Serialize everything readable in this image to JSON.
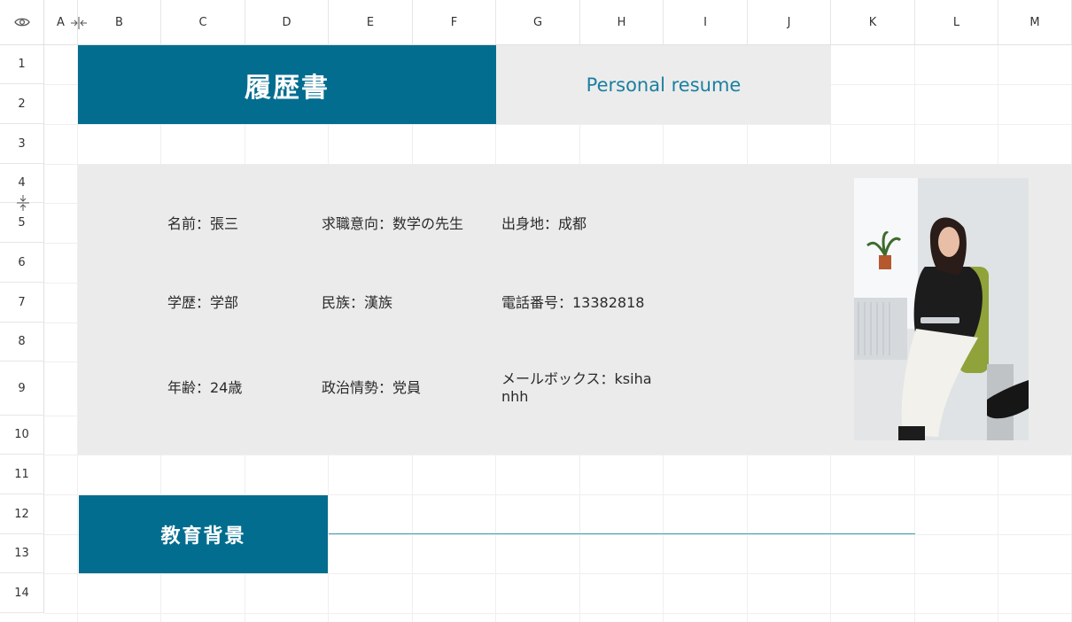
{
  "columns": [
    "A",
    "B",
    "C",
    "D",
    "E",
    "F",
    "G",
    "H",
    "I",
    "J",
    "K",
    "L",
    "M"
  ],
  "rows": [
    "1",
    "2",
    "3",
    "4",
    "5",
    "6",
    "7",
    "8",
    "9",
    "10",
    "11",
    "12",
    "13",
    "14"
  ],
  "icons": {
    "corner": "eye-icon",
    "column_resize": "column-resize-icon",
    "row_resize": "row-resize-icon"
  },
  "header": {
    "title": "履歴書",
    "subtitle": "Personal resume"
  },
  "info": {
    "name": "名前：張三",
    "objective": "求職意向：数学の先生",
    "birthplace": "出身地：成都",
    "education": "学歴：学部",
    "ethnicity": "民族：漢族",
    "phone": "電話番号：13382818",
    "age": "年齢：24歳",
    "political": "政治情勢：党員",
    "email": "メールボックス：ksihanhh"
  },
  "section": {
    "title": "教育背景"
  },
  "colors": {
    "accent": "#036d8f",
    "accent_text": "#1b7fa0",
    "panel": "#ebebeb",
    "section_line": "#3a9cb4"
  }
}
